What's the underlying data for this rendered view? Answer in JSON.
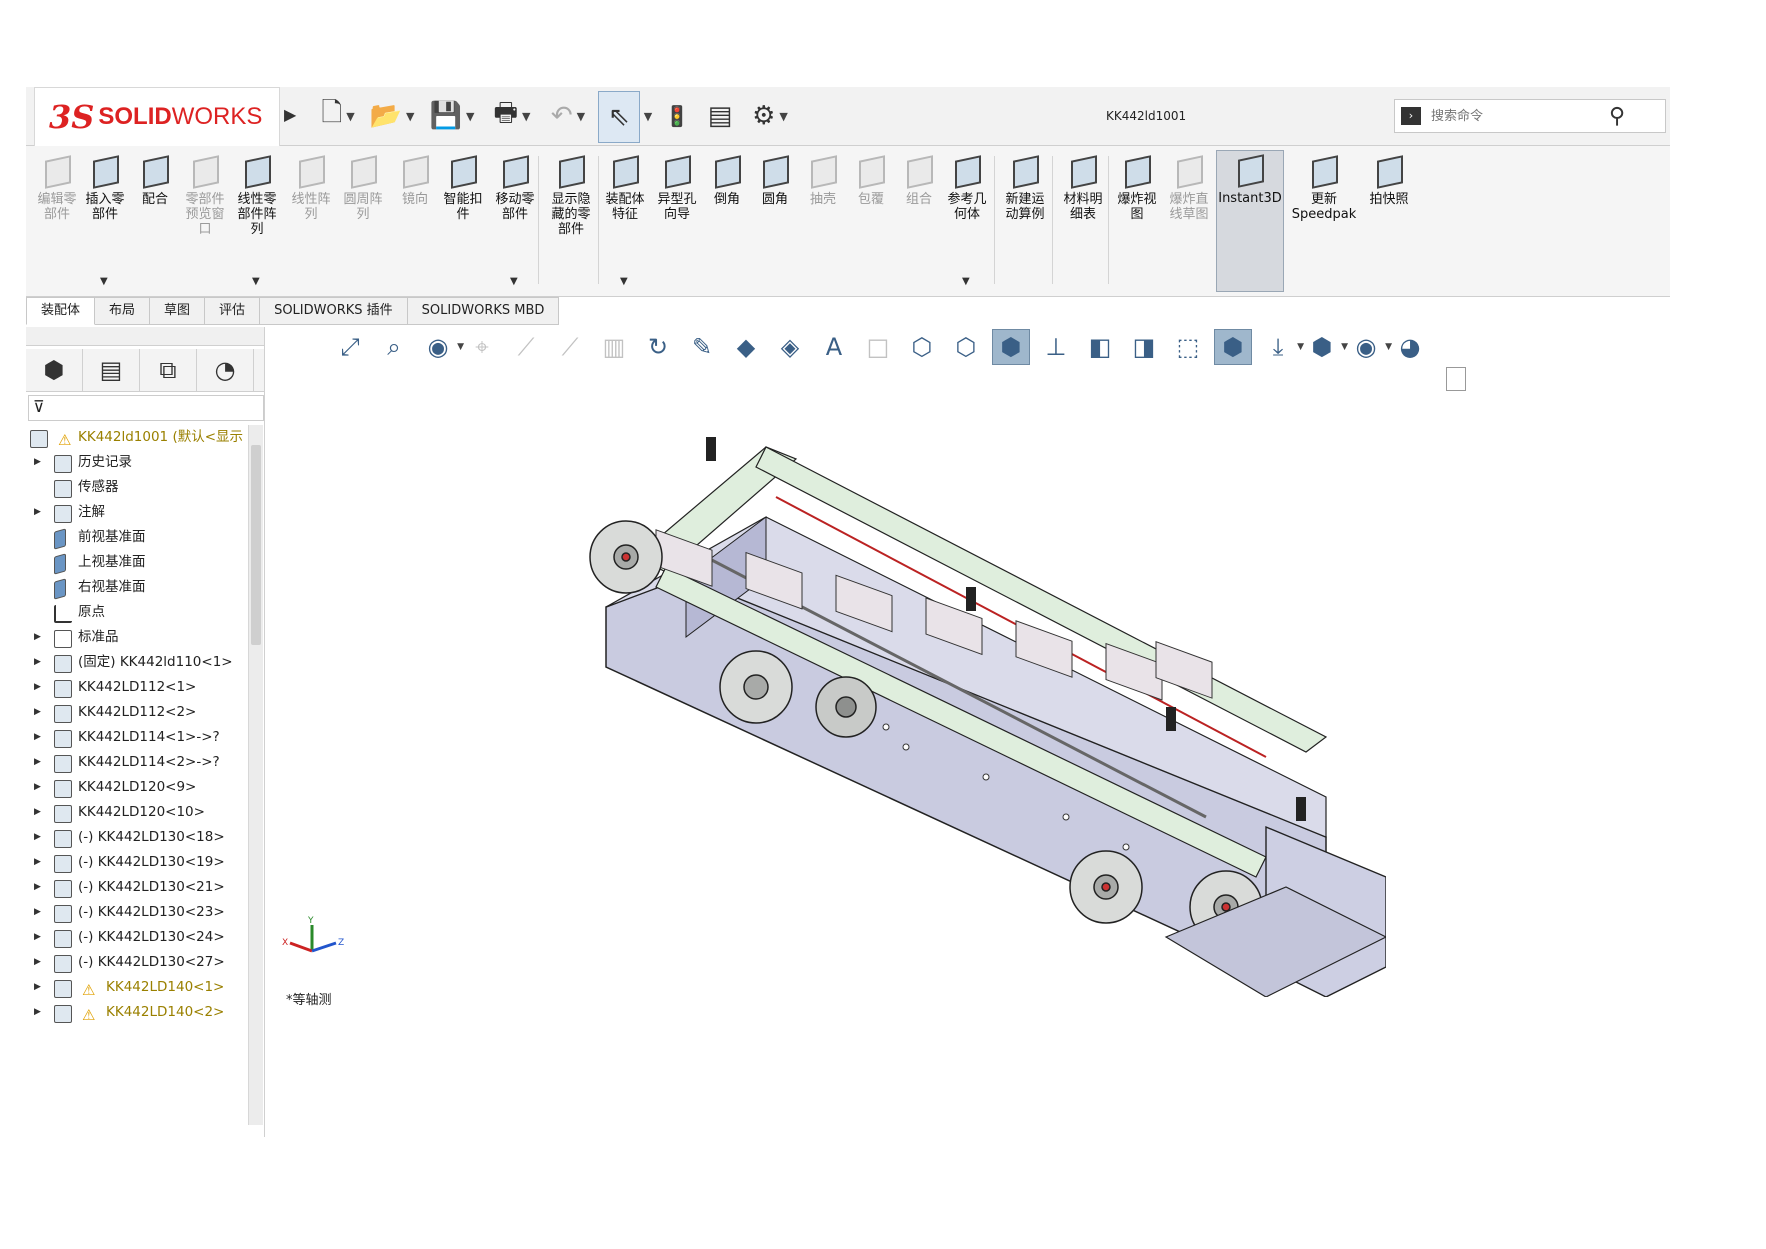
{
  "app": {
    "logo_ds": "3S",
    "logo_solid": "SOLID",
    "logo_works": "WORKS",
    "document_title": "KK442ld1001"
  },
  "search": {
    "placeholder": "搜索命令"
  },
  "quick_access": [
    {
      "name": "new-document",
      "icon": "new-document-icon"
    },
    {
      "name": "open",
      "icon": "open-folder-icon"
    },
    {
      "name": "save",
      "icon": "save-icon"
    },
    {
      "name": "print",
      "icon": "print-icon"
    },
    {
      "name": "undo",
      "icon": "undo-icon"
    },
    {
      "name": "select",
      "icon": "pointer-icon"
    },
    {
      "name": "rebuild",
      "icon": "traffic-light-icon"
    },
    {
      "name": "file-properties",
      "icon": "list-icon"
    },
    {
      "name": "options",
      "icon": "gear-icon"
    }
  ],
  "ribbon": {
    "buttons": [
      {
        "label": "编辑零\n部件",
        "disabled": true
      },
      {
        "label": "插入零\n部件",
        "disabled": false
      },
      {
        "label": "配合",
        "disabled": false
      },
      {
        "label": "零部件\n预览窗\n口",
        "disabled": true
      },
      {
        "label": "线性零\n部件阵\n列",
        "disabled": false
      },
      {
        "label": "线性阵\n列",
        "disabled": true
      },
      {
        "label": "圆周阵\n列",
        "disabled": true
      },
      {
        "label": "镜向",
        "disabled": true
      },
      {
        "label": "智能扣\n件",
        "disabled": false
      },
      {
        "label": "移动零\n部件",
        "disabled": false
      },
      {
        "label": "显示隐\n藏的零\n部件",
        "disabled": false
      },
      {
        "label": "装配体\n特征",
        "disabled": false
      },
      {
        "label": "异型孔\n向导",
        "disabled": false
      },
      {
        "label": "倒角",
        "disabled": false
      },
      {
        "label": "圆角",
        "disabled": false
      },
      {
        "label": "抽壳",
        "disabled": true
      },
      {
        "label": "包覆",
        "disabled": true
      },
      {
        "label": "组合",
        "disabled": true
      },
      {
        "label": "参考几\n何体",
        "disabled": false
      },
      {
        "label": "新建运\n动算例",
        "disabled": false
      },
      {
        "label": "材料明\n细表",
        "disabled": false
      },
      {
        "label": "爆炸视\n图",
        "disabled": false
      },
      {
        "label": "爆炸直\n线草图",
        "disabled": true
      },
      {
        "label": "Instant3D",
        "disabled": false,
        "active": true
      },
      {
        "label": "更新\nSpeedpak",
        "disabled": false
      },
      {
        "label": "拍快照",
        "disabled": false
      }
    ]
  },
  "tabs": [
    "装配体",
    "布局",
    "草图",
    "评估",
    "SOLIDWORKS 插件",
    "SOLIDWORKS MBD"
  ],
  "feature_tree": {
    "root": "KK442ld1001  (默认<显示",
    "items": [
      {
        "label": "历史记录",
        "type": "folder",
        "expand": true
      },
      {
        "label": "传感器",
        "type": "folder",
        "expand": false
      },
      {
        "label": "注解",
        "type": "folder",
        "expand": true
      },
      {
        "label": "前视基准面",
        "type": "plane",
        "expand": false
      },
      {
        "label": "上视基准面",
        "type": "plane",
        "expand": false
      },
      {
        "label": "右视基准面",
        "type": "plane",
        "expand": false
      },
      {
        "label": "原点",
        "type": "origin",
        "expand": false
      },
      {
        "label": "标准品",
        "type": "folder",
        "expand": true
      },
      {
        "label": "(固定) KK442ld110<1>",
        "type": "part",
        "expand": true
      },
      {
        "label": "KK442LD112<1>",
        "type": "part",
        "expand": true
      },
      {
        "label": "KK442LD112<2>",
        "type": "part",
        "expand": true
      },
      {
        "label": "KK442LD114<1>->?",
        "type": "part",
        "expand": true
      },
      {
        "label": "KK442LD114<2>->?",
        "type": "part",
        "expand": true
      },
      {
        "label": "KK442LD120<9>",
        "type": "part",
        "expand": true
      },
      {
        "label": "KK442LD120<10>",
        "type": "part",
        "expand": true
      },
      {
        "label": "(-) KK442LD130<18>",
        "type": "part",
        "expand": true
      },
      {
        "label": "(-) KK442LD130<19>",
        "type": "part",
        "expand": true
      },
      {
        "label": "(-) KK442LD130<21>",
        "type": "part",
        "expand": true
      },
      {
        "label": "(-) KK442LD130<23>",
        "type": "part",
        "expand": true
      },
      {
        "label": "(-) KK442LD130<24>",
        "type": "part",
        "expand": true
      },
      {
        "label": "(-) KK442LD130<27>",
        "type": "part",
        "expand": true
      },
      {
        "label": "KK442LD140<1>",
        "type": "part",
        "expand": true,
        "warning": true
      },
      {
        "label": "KK442LD140<2>",
        "type": "part",
        "expand": true,
        "warning": true
      }
    ]
  },
  "viewport": {
    "triad_labels": {
      "x": "X",
      "y": "Y",
      "z": "Z"
    },
    "bottom_label": "*等轴测",
    "view_tools": [
      {
        "icon": "zoom-to-fit-icon"
      },
      {
        "icon": "zoom-area-icon"
      },
      {
        "icon": "previous-view-icon"
      },
      {
        "icon": "section-view-icon",
        "off": true
      },
      {
        "icon": "dynamic-annotation-icon",
        "off": true
      },
      {
        "icon": "view-orientation-icon",
        "off": true
      },
      {
        "icon": "display-style-icon",
        "off": true
      },
      {
        "icon": "rotate-icon"
      },
      {
        "icon": "sketch-icon"
      },
      {
        "icon": "hide-show-icon"
      },
      {
        "icon": "appearance-icon"
      },
      {
        "icon": "scene-icon"
      },
      {
        "icon": "box-icon",
        "off": true
      },
      {
        "icon": "wireframe-icon"
      },
      {
        "icon": "hidden-lines-icon"
      },
      {
        "icon": "shaded-edges-icon",
        "on": true
      },
      {
        "icon": "normal-to-icon"
      },
      {
        "icon": "front-view-icon"
      },
      {
        "icon": "top-view-icon"
      },
      {
        "icon": "right-view-icon"
      },
      {
        "icon": "isometric-view-icon",
        "on": true
      },
      {
        "icon": "view-selector-icon"
      },
      {
        "icon": "cube-view-icon"
      },
      {
        "icon": "visibility-icon"
      },
      {
        "icon": "color-wheel-icon"
      }
    ]
  }
}
